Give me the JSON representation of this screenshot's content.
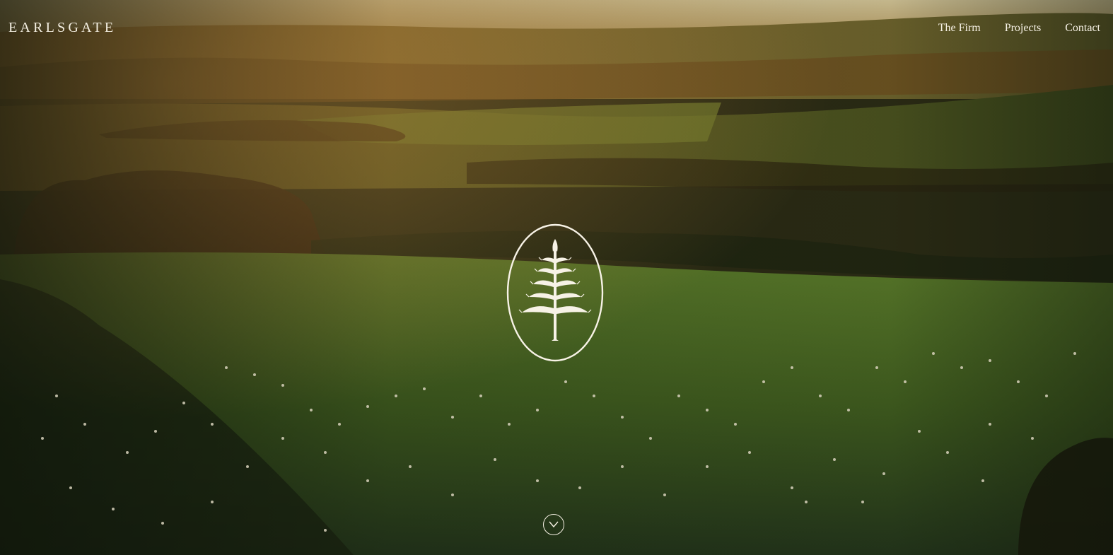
{
  "brand": {
    "name": "EARLSGATE"
  },
  "nav": {
    "items": [
      {
        "label": "The Firm"
      },
      {
        "label": "Projects"
      },
      {
        "label": "Contact"
      }
    ]
  },
  "hero": {
    "background": "rolling-countryside-sheep-field-photo",
    "emblem_icon": "pine-tree-oval-emblem-icon",
    "scroll_icon": "chevron-down-icon"
  },
  "colors": {
    "text_light": "#f7f2e6",
    "field_green": "#3e5a1e",
    "sky_haze": "#c9b98a",
    "sunlight": "#b78b3a"
  }
}
